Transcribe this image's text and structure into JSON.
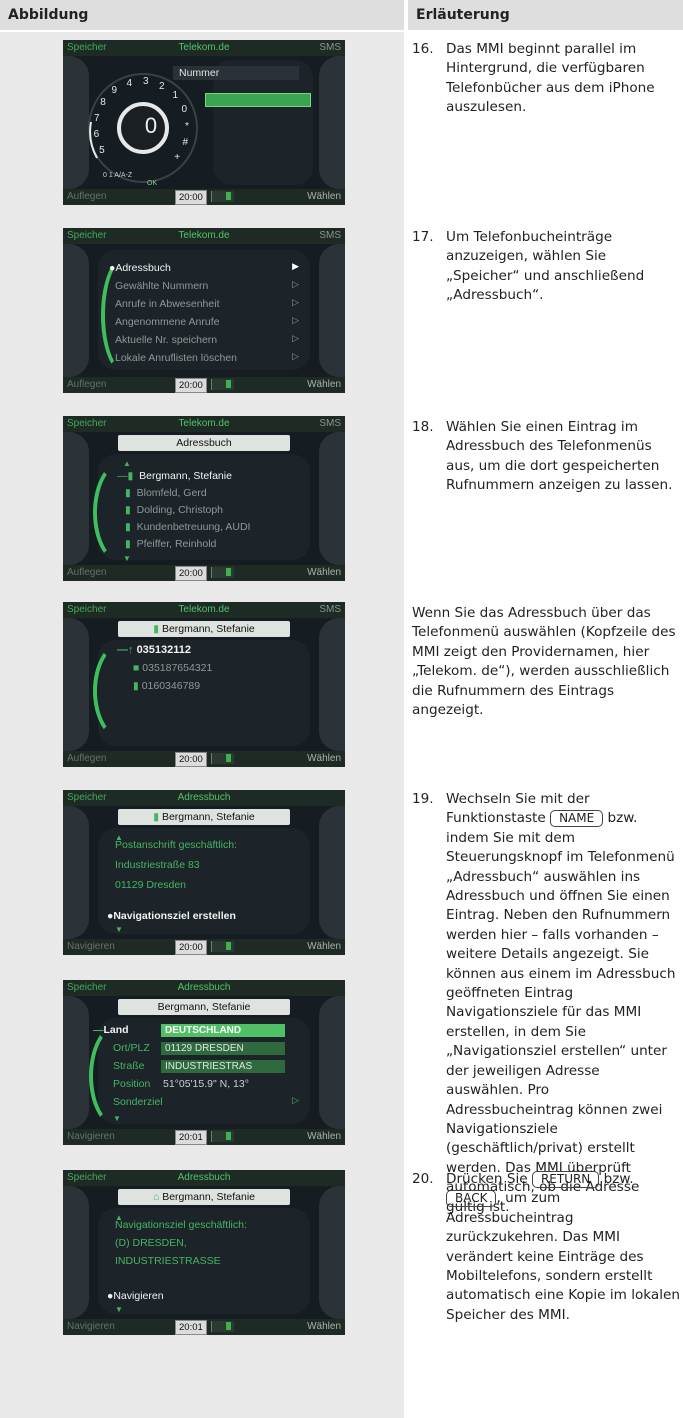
{
  "header": {
    "left": "Abbildung",
    "right": "Erläuterung"
  },
  "screens": [
    {
      "top": {
        "left": "Speicher",
        "center": "Telekom.de",
        "right": "SMS"
      },
      "bottom": {
        "left": "Auflegen",
        "clock": "20:00",
        "right": "Wählen"
      },
      "title": "Nummer",
      "speller": {
        "digits": [
          "5",
          "6",
          "7",
          "8",
          "9",
          "4",
          "3",
          "2",
          "1",
          "0",
          "*",
          "#",
          "+"
        ],
        "center": "0",
        "mode": "0 1 A/A-Z",
        "ok": "OK"
      }
    },
    {
      "top": {
        "left": "Speicher",
        "center": "Telekom.de",
        "right": "SMS"
      },
      "bottom": {
        "left": "Auflegen",
        "clock": "20:00",
        "right": "Wählen"
      },
      "items": [
        "Adressbuch",
        "Gewählte Nummern",
        "Anrufe in Abwesenheit",
        "Angenommene Anrufe",
        "Aktuelle Nr. speichern",
        "Lokale Anruflisten löschen"
      ]
    },
    {
      "top": {
        "left": "Speicher",
        "center": "Telekom.de",
        "right": "SMS"
      },
      "bottom": {
        "left": "Auflegen",
        "clock": "20:00",
        "right": "Wählen"
      },
      "title": "Adressbuch",
      "items": [
        "Bergmann, Stefanie",
        "Blomfeld, Gerd",
        "Dolding, Christoph",
        "Kundenbetreuung, AUDI",
        "Pfeiffer, Reinhold"
      ]
    },
    {
      "top": {
        "left": "Speicher",
        "center": "Telekom.de",
        "right": "SMS"
      },
      "bottom": {
        "left": "Auflegen",
        "clock": "20:00",
        "right": "Wählen"
      },
      "title": "Bergmann, Stefanie",
      "items": [
        "035132112",
        "035187654321",
        "0160346789"
      ]
    },
    {
      "top": {
        "left": "Speicher",
        "center": "Adressbuch",
        "right": ""
      },
      "bottom": {
        "left": "Navigieren",
        "clock": "20:00",
        "right": "Wählen"
      },
      "title": "Bergmann, Stefanie",
      "lines": [
        "Postanschrift geschäftlich:",
        "Industriestraße 83",
        "01129 Dresden"
      ],
      "action": "Navigationsziel erstellen"
    },
    {
      "top": {
        "left": "Speicher",
        "center": "Adressbuch",
        "right": ""
      },
      "bottom": {
        "left": "Navigieren",
        "clock": "20:01",
        "right": "Wählen"
      },
      "title": "Bergmann, Stefanie",
      "fields": [
        {
          "label": "Land",
          "value": "DEUTSCHLAND"
        },
        {
          "label": "Ort/PLZ",
          "value": "01129 DRESDEN"
        },
        {
          "label": "Straße",
          "value": "INDUSTRIESTRAS"
        },
        {
          "label": "Position",
          "value": "51°05'15.9\" N, 13°"
        }
      ],
      "extra": "Sonderziel"
    },
    {
      "top": {
        "left": "Speicher",
        "center": "Adressbuch",
        "right": ""
      },
      "bottom": {
        "left": "Navigieren",
        "clock": "20:01",
        "right": "Wählen"
      },
      "title": "Bergmann, Stefanie",
      "lines": [
        "Navigationsziel geschäftlich:",
        "(D) DRESDEN,",
        "INDUSTRIESTRASSE"
      ],
      "action": "Navigieren"
    }
  ],
  "explanations": {
    "s16": {
      "num": "16.",
      "text": "Das MMI beginnt parallel im Hintergrund, die verfügbaren Telefonbücher aus dem iPhone auszulesen."
    },
    "s17": {
      "num": "17.",
      "text": "Um Telefonbucheinträge anzuzeigen, wählen Sie „Speicher“ und anschließend „Adressbuch“."
    },
    "s18": {
      "num": "18.",
      "text": "Wählen Sie einen Eintrag im Adressbuch des Telefonmenüs aus, um die dort gespeicherten Rufnummern anzeigen zu lassen."
    },
    "note": "Wenn Sie das Adressbuch über das Telefonmenü auswählen (Kopfzeile des MMI zeigt den Providernamen, hier „Telekom. de“), werden ausschließlich die Rufnummern des Eintrags angezeigt.",
    "s19": {
      "num": "19.",
      "a": "Wechseln Sie mit der Funktionstaste",
      "key": "NAME",
      "b": "bzw. indem Sie mit dem Steuerungsknopf im Telefonmenü „Adressbuch“ auswählen ins Adressbuch und öffnen Sie einen Eintrag. Neben den Rufnummern werden hier – falls vorhanden – weitere Details angezeigt. Sie können aus einem im Adressbuch geöffneten Eintrag Navigationsziele für das MMI erstellen, in dem Sie „Navigationsziel erstellen“ unter der jeweiligen Adresse auswählen. Pro Adressbucheintrag können zwei Navigationsziele (geschäftlich/privat) erstellt werden. Das MMI überprüft automatisch, ob die Adresse gültig ist."
    },
    "s20": {
      "num": "20.",
      "a": "Drücken Sie",
      "key1": "RETURN",
      "b": "bzw.",
      "key2": "BACK",
      "c": ", um zum Adressbucheintrag zurückzukehren. Das MMI verändert keine Einträge des Mobiltelefons, sondern erstellt automatisch eine Kopie im lokalen Speicher des MMI."
    }
  }
}
